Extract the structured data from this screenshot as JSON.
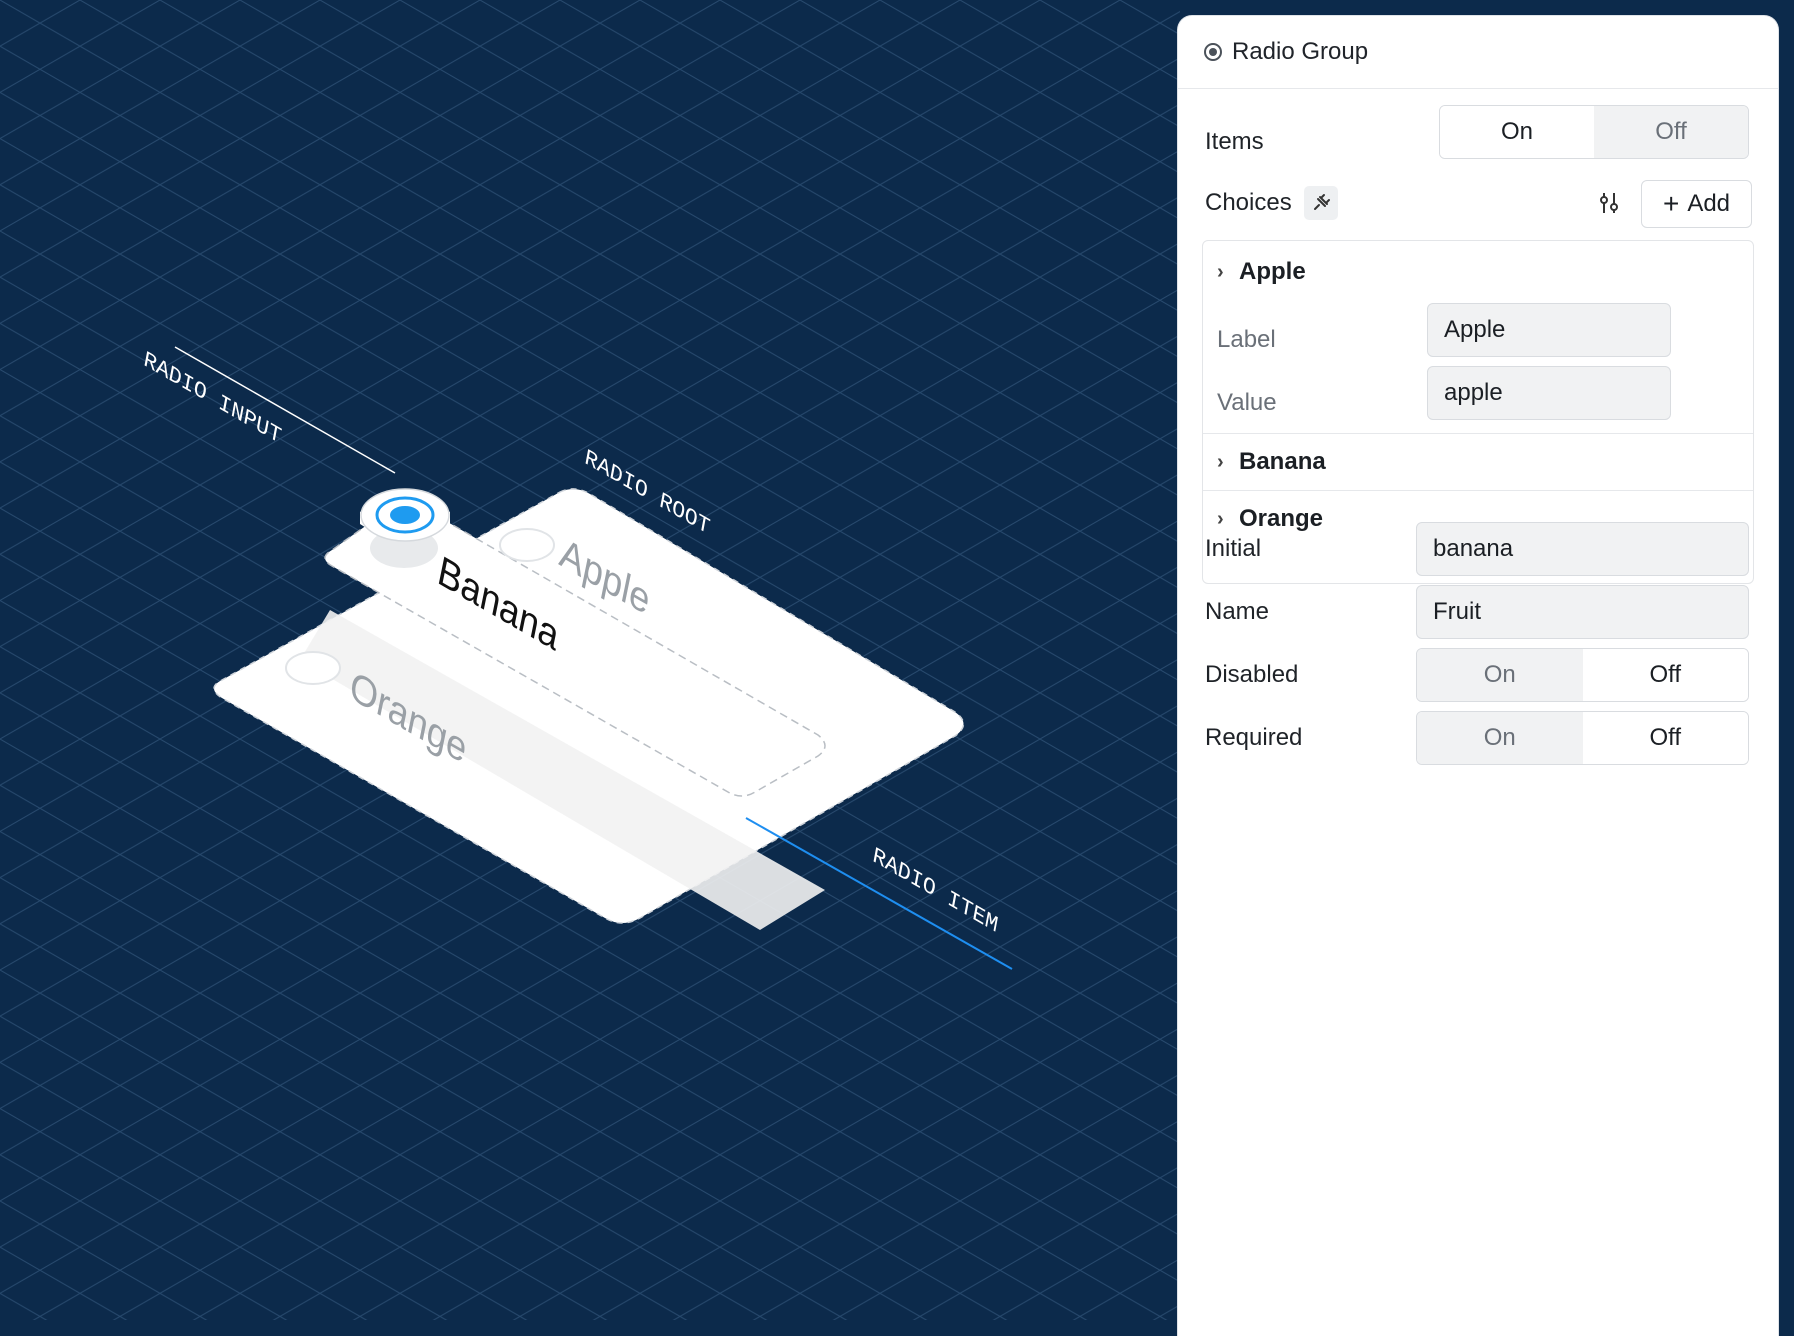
{
  "canvas": {
    "callouts": {
      "radio_input": "RADIO INPUT",
      "radio_root": "RADIO ROOT",
      "radio_item": "RADIO ITEM"
    },
    "options": [
      "Apple",
      "Banana",
      "Orange"
    ],
    "selected": "Banana",
    "colors": {
      "background": "#0c2a4b",
      "accent": "#1e9bf0",
      "grid": "#2a4a6c"
    }
  },
  "panel": {
    "title": "Radio Group",
    "title_icon": "radio-group-icon",
    "items": {
      "label": "Items",
      "on": "On",
      "off": "Off",
      "value": "On"
    },
    "choices": {
      "label": "Choices",
      "icon": "plug-icon",
      "settings_icon": "sliders-icon",
      "add_label": "Add",
      "list": [
        {
          "title": "Apple",
          "expanded": true,
          "label_caption": "Label",
          "label_value": "Apple",
          "value_caption": "Value",
          "value_value": "apple"
        },
        {
          "title": "Banana",
          "expanded": false
        },
        {
          "title": "Orange",
          "expanded": false
        }
      ]
    },
    "initial": {
      "label": "Initial",
      "value": "banana"
    },
    "name": {
      "label": "Name",
      "value": "Fruit"
    },
    "disabled": {
      "label": "Disabled",
      "on": "On",
      "off": "Off",
      "value": "Off"
    },
    "required": {
      "label": "Required",
      "on": "On",
      "off": "Off",
      "value": "Off"
    }
  }
}
